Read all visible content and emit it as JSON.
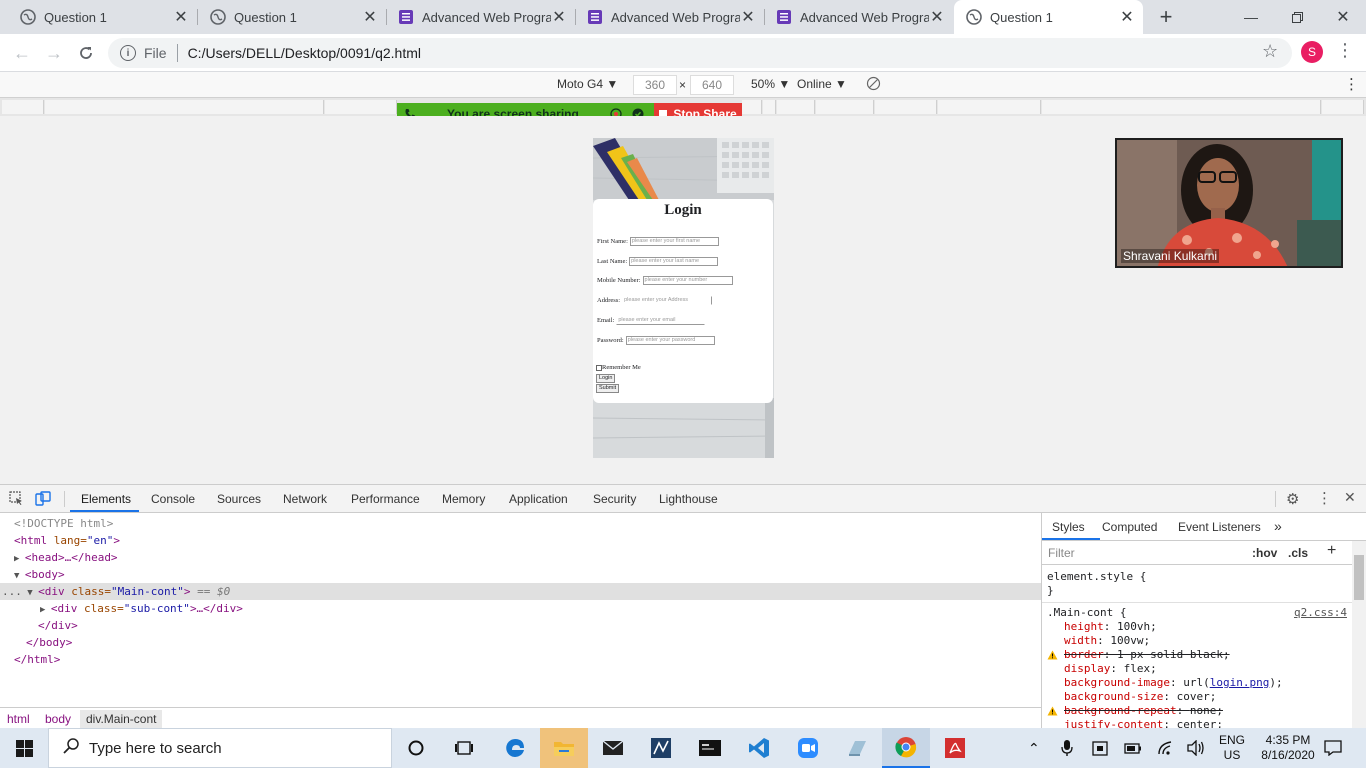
{
  "browser": {
    "tabs": [
      {
        "label": "Question 1",
        "type": "globe",
        "active": false
      },
      {
        "label": "Question 1",
        "type": "globe",
        "active": false
      },
      {
        "label": "Advanced Web Program",
        "type": "form",
        "active": false
      },
      {
        "label": "Advanced Web Program",
        "type": "form",
        "active": false
      },
      {
        "label": "Advanced Web Program",
        "type": "form",
        "active": false
      },
      {
        "label": "Question 1",
        "type": "globe",
        "active": true
      }
    ],
    "new_tab_symbol": "+",
    "address": {
      "scheme": "File",
      "url": "C:/Users/DELL/Desktop/0091/q2.html"
    },
    "profile_initial": "S",
    "accent_color": "#1a73e8"
  },
  "device_toolbar": {
    "device": "Moto G4 ▼",
    "width": "360",
    "height": "640",
    "times": "×",
    "zoom": "50% ▼",
    "network": "Online ▼"
  },
  "screen_share": {
    "status": "You are screen sharing",
    "stop_label": "Stop Share",
    "green": "#4caf1f",
    "red": "#e53935"
  },
  "page": {
    "title": "Login",
    "fields": [
      {
        "label": "First Name:",
        "placeholder": "please enter your first name"
      },
      {
        "label": "Last Name:",
        "placeholder": "please enter your last name"
      },
      {
        "label": "Mobile Number:",
        "placeholder": "please enter your number"
      },
      {
        "label": "Address:",
        "placeholder": "please enter your Address"
      },
      {
        "label": "Email:",
        "placeholder": "please enter your email"
      },
      {
        "label": "Password:",
        "placeholder": "please enter your password"
      }
    ],
    "remember": "Remember Me",
    "login_button": "Login",
    "submit_button": "Submit"
  },
  "webcam": {
    "name": "Shravani Kulkarni"
  },
  "devtools": {
    "tabs": [
      "Elements",
      "Console",
      "Sources",
      "Network",
      "Performance",
      "Memory",
      "Application",
      "Security",
      "Lighthouse"
    ],
    "dom": {
      "doctype": "<!DOCTYPE html>",
      "html_open_tag": "<html",
      "html_attr": " lang=",
      "html_val": "\"en\"",
      "html_close": ">",
      "head": "<head>…</head>",
      "body_open": "<body>",
      "div_open": "<div",
      "div_attr": " class=",
      "div_val": "\"Main-cont\"",
      "div_close": ">",
      "div_marker": " == $0",
      "sub_open": "<div",
      "sub_attr": " class=",
      "sub_val": "\"sub-cont\"",
      "sub_close": ">…</div>",
      "div_end": "</div>",
      "body_end": "</body>",
      "html_end": "</html>",
      "ellipsis": "..."
    },
    "breadcrumbs": [
      "html",
      "body",
      "div.Main-cont"
    ],
    "styles_tabs": [
      "Styles",
      "Computed",
      "Event Listeners",
      "»"
    ],
    "filter_placeholder": "Filter",
    "hov": ":hov",
    "cls": ".cls",
    "plus": "+",
    "element_style": "element.style {",
    "element_style_close": "}",
    "rule_selector": ".Main-cont {",
    "rule_source": "q2.css:4",
    "props": [
      {
        "name": "height",
        "value": "100vh;",
        "struck": false,
        "warn": false
      },
      {
        "name": "width",
        "value": "100vw;",
        "struck": false,
        "warn": false
      },
      {
        "name": "border",
        "value": "1 px solid black;",
        "struck": true,
        "warn": true
      },
      {
        "name": "display",
        "value": "flex;",
        "struck": false,
        "warn": false
      },
      {
        "name": "background-image",
        "value": "url(",
        "link": "login.png",
        "after": ");",
        "struck": false,
        "warn": false
      },
      {
        "name": "background-size",
        "value": "cover;",
        "struck": false,
        "warn": false
      },
      {
        "name": "background-repeat",
        "value": "none;",
        "struck": true,
        "warn": true
      },
      {
        "name": "justify-content",
        "value": "center;",
        "struck": false,
        "warn": false
      }
    ]
  },
  "taskbar": {
    "search_placeholder": "Type here to search",
    "lang": "ENG",
    "region": "US",
    "time": "4:35 PM",
    "date": "8/16/2020"
  }
}
